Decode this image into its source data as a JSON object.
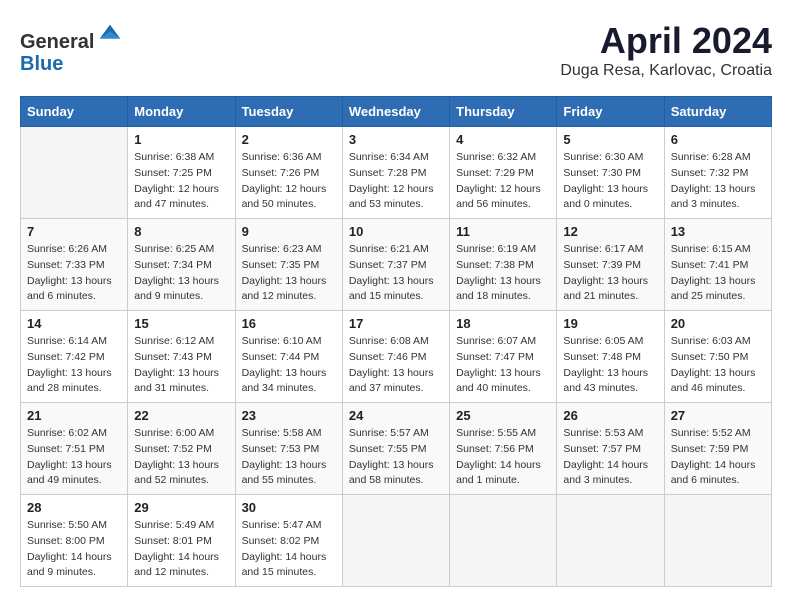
{
  "header": {
    "logo_line1": "General",
    "logo_line2": "Blue",
    "title": "April 2024",
    "subtitle": "Duga Resa, Karlovac, Croatia"
  },
  "calendar": {
    "days_of_week": [
      "Sunday",
      "Monday",
      "Tuesday",
      "Wednesday",
      "Thursday",
      "Friday",
      "Saturday"
    ],
    "weeks": [
      [
        {
          "day": "",
          "info": ""
        },
        {
          "day": "1",
          "info": "Sunrise: 6:38 AM\nSunset: 7:25 PM\nDaylight: 12 hours\nand 47 minutes."
        },
        {
          "day": "2",
          "info": "Sunrise: 6:36 AM\nSunset: 7:26 PM\nDaylight: 12 hours\nand 50 minutes."
        },
        {
          "day": "3",
          "info": "Sunrise: 6:34 AM\nSunset: 7:28 PM\nDaylight: 12 hours\nand 53 minutes."
        },
        {
          "day": "4",
          "info": "Sunrise: 6:32 AM\nSunset: 7:29 PM\nDaylight: 12 hours\nand 56 minutes."
        },
        {
          "day": "5",
          "info": "Sunrise: 6:30 AM\nSunset: 7:30 PM\nDaylight: 13 hours\nand 0 minutes."
        },
        {
          "day": "6",
          "info": "Sunrise: 6:28 AM\nSunset: 7:32 PM\nDaylight: 13 hours\nand 3 minutes."
        }
      ],
      [
        {
          "day": "7",
          "info": "Sunrise: 6:26 AM\nSunset: 7:33 PM\nDaylight: 13 hours\nand 6 minutes."
        },
        {
          "day": "8",
          "info": "Sunrise: 6:25 AM\nSunset: 7:34 PM\nDaylight: 13 hours\nand 9 minutes."
        },
        {
          "day": "9",
          "info": "Sunrise: 6:23 AM\nSunset: 7:35 PM\nDaylight: 13 hours\nand 12 minutes."
        },
        {
          "day": "10",
          "info": "Sunrise: 6:21 AM\nSunset: 7:37 PM\nDaylight: 13 hours\nand 15 minutes."
        },
        {
          "day": "11",
          "info": "Sunrise: 6:19 AM\nSunset: 7:38 PM\nDaylight: 13 hours\nand 18 minutes."
        },
        {
          "day": "12",
          "info": "Sunrise: 6:17 AM\nSunset: 7:39 PM\nDaylight: 13 hours\nand 21 minutes."
        },
        {
          "day": "13",
          "info": "Sunrise: 6:15 AM\nSunset: 7:41 PM\nDaylight: 13 hours\nand 25 minutes."
        }
      ],
      [
        {
          "day": "14",
          "info": "Sunrise: 6:14 AM\nSunset: 7:42 PM\nDaylight: 13 hours\nand 28 minutes."
        },
        {
          "day": "15",
          "info": "Sunrise: 6:12 AM\nSunset: 7:43 PM\nDaylight: 13 hours\nand 31 minutes."
        },
        {
          "day": "16",
          "info": "Sunrise: 6:10 AM\nSunset: 7:44 PM\nDaylight: 13 hours\nand 34 minutes."
        },
        {
          "day": "17",
          "info": "Sunrise: 6:08 AM\nSunset: 7:46 PM\nDaylight: 13 hours\nand 37 minutes."
        },
        {
          "day": "18",
          "info": "Sunrise: 6:07 AM\nSunset: 7:47 PM\nDaylight: 13 hours\nand 40 minutes."
        },
        {
          "day": "19",
          "info": "Sunrise: 6:05 AM\nSunset: 7:48 PM\nDaylight: 13 hours\nand 43 minutes."
        },
        {
          "day": "20",
          "info": "Sunrise: 6:03 AM\nSunset: 7:50 PM\nDaylight: 13 hours\nand 46 minutes."
        }
      ],
      [
        {
          "day": "21",
          "info": "Sunrise: 6:02 AM\nSunset: 7:51 PM\nDaylight: 13 hours\nand 49 minutes."
        },
        {
          "day": "22",
          "info": "Sunrise: 6:00 AM\nSunset: 7:52 PM\nDaylight: 13 hours\nand 52 minutes."
        },
        {
          "day": "23",
          "info": "Sunrise: 5:58 AM\nSunset: 7:53 PM\nDaylight: 13 hours\nand 55 minutes."
        },
        {
          "day": "24",
          "info": "Sunrise: 5:57 AM\nSunset: 7:55 PM\nDaylight: 13 hours\nand 58 minutes."
        },
        {
          "day": "25",
          "info": "Sunrise: 5:55 AM\nSunset: 7:56 PM\nDaylight: 14 hours\nand 1 minute."
        },
        {
          "day": "26",
          "info": "Sunrise: 5:53 AM\nSunset: 7:57 PM\nDaylight: 14 hours\nand 3 minutes."
        },
        {
          "day": "27",
          "info": "Sunrise: 5:52 AM\nSunset: 7:59 PM\nDaylight: 14 hours\nand 6 minutes."
        }
      ],
      [
        {
          "day": "28",
          "info": "Sunrise: 5:50 AM\nSunset: 8:00 PM\nDaylight: 14 hours\nand 9 minutes."
        },
        {
          "day": "29",
          "info": "Sunrise: 5:49 AM\nSunset: 8:01 PM\nDaylight: 14 hours\nand 12 minutes."
        },
        {
          "day": "30",
          "info": "Sunrise: 5:47 AM\nSunset: 8:02 PM\nDaylight: 14 hours\nand 15 minutes."
        },
        {
          "day": "",
          "info": ""
        },
        {
          "day": "",
          "info": ""
        },
        {
          "day": "",
          "info": ""
        },
        {
          "day": "",
          "info": ""
        }
      ]
    ]
  }
}
